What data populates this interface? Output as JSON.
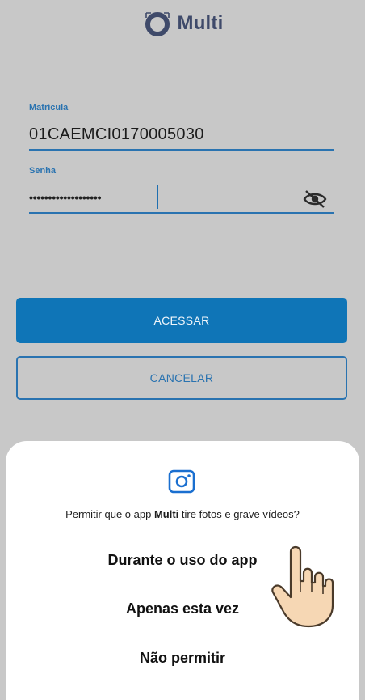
{
  "app": {
    "logo_text": "Multi"
  },
  "form": {
    "matricula": {
      "label": "Matrícula",
      "value": "01CAEMCI0170005030"
    },
    "senha": {
      "label": "Senha",
      "masked_value": "•••••••••••••••••••"
    },
    "toggle_visibility_icon": "eye-off-icon"
  },
  "buttons": {
    "acessar": "ACESSAR",
    "cancelar": "CANCELAR"
  },
  "permission_dialog": {
    "icon": "camera-icon",
    "question_prefix": "Permitir que o app ",
    "app_name": "Multi",
    "question_suffix": " tire fotos e grave vídeos?",
    "options": [
      "Durante o uso do app",
      "Apenas esta vez",
      "Não permitir"
    ]
  },
  "colors": {
    "accent": "#0f75b7",
    "background": "#c8c8c8",
    "sheet": "#ffffff",
    "logo_text": "#3f4a6a"
  }
}
